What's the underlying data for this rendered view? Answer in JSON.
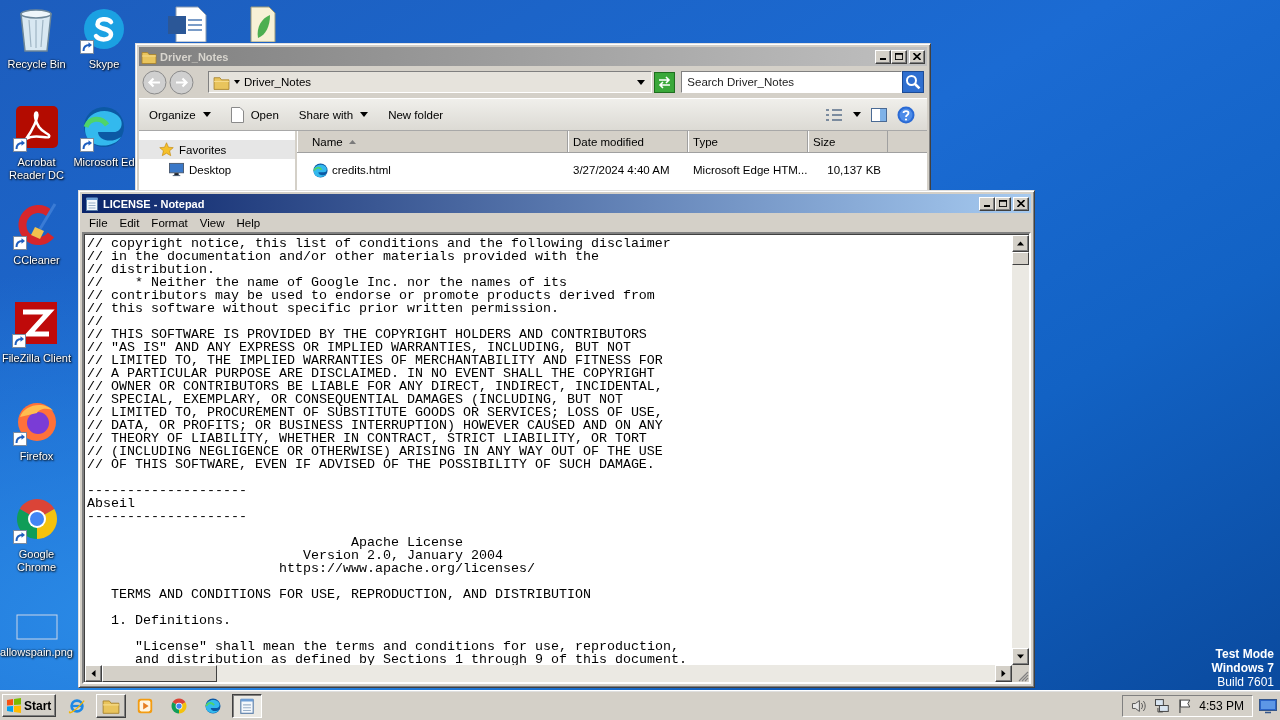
{
  "desktop": {
    "icon_columns": [
      [
        {
          "kind": "recycle-bin",
          "label": "Recycle Bin",
          "shortcut": false
        },
        {
          "kind": "acrobat",
          "label": "Acrobat Reader DC",
          "shortcut": true
        },
        {
          "kind": "ccleaner",
          "label": "CCleaner",
          "shortcut": true
        },
        {
          "kind": "filezilla",
          "label": "FileZilla Client",
          "shortcut": true
        },
        {
          "kind": "firefox",
          "label": "Firefox",
          "shortcut": true
        },
        {
          "kind": "chrome",
          "label": "Google Chrome",
          "shortcut": true
        },
        {
          "kind": "image-file",
          "label": "allowspain.png",
          "shortcut": false
        }
      ],
      [
        {
          "kind": "skype",
          "label": "Skype",
          "shortcut": true
        },
        {
          "kind": "edge",
          "label": "Microsoft Ed",
          "shortcut": true
        }
      ],
      [
        {
          "kind": "word-document"
        }
      ],
      [
        {
          "kind": "document"
        }
      ]
    ],
    "edition_lines": [
      "Test Mode",
      "Windows 7"
    ],
    "build": "Build 7601"
  },
  "explorer": {
    "title": "Driver_Notes",
    "active": false,
    "address": "Driver_Notes",
    "search": {
      "placeholder": "Search Driver_Notes"
    },
    "toolbar": [
      {
        "kind": "menu",
        "label": "Organize"
      },
      {
        "kind": "icon-command",
        "label": "Open"
      },
      {
        "kind": "menu",
        "label": "Share with"
      },
      {
        "kind": "command",
        "label": "New folder"
      }
    ],
    "nav": [
      {
        "kind": "group",
        "label": "Favorites"
      },
      {
        "kind": "location",
        "label": "Desktop"
      }
    ],
    "columns": [
      {
        "label": "Name",
        "sorted": true
      },
      {
        "label": "Date modified",
        "sorted": false
      },
      {
        "label": "Type",
        "sorted": false
      },
      {
        "label": "Size",
        "sorted": false
      }
    ],
    "rows": [
      {
        "name": "credits.html",
        "date_modified": "3/27/2024 4:40 AM",
        "type": "Microsoft Edge HTM...",
        "size": "10,137 KB"
      }
    ]
  },
  "notepad": {
    "title": "LICENSE - Notepad",
    "active": true,
    "menu": [
      "File",
      "Edit",
      "Format",
      "View",
      "Help"
    ],
    "text_blocks": [
      {
        "lines": [
          "// copyright notice, this list of conditions and the following disclaimer",
          "// in the documentation and/or other materials provided with the",
          "// distribution.",
          "//    * Neither the name of Google Inc. nor the names of its",
          "// contributors may be used to endorse or promote products derived from",
          "// this software without specific prior written permission.",
          "//",
          "// THIS SOFTWARE IS PROVIDED BY THE COPYRIGHT HOLDERS AND CONTRIBUTORS",
          "// \"AS IS\" AND ANY EXPRESS OR IMPLIED WARRANTIES, INCLUDING, BUT NOT",
          "// LIMITED TO, THE IMPLIED WARRANTIES OF MERCHANTABILITY AND FITNESS FOR",
          "// A PARTICULAR PURPOSE ARE DISCLAIMED. IN NO EVENT SHALL THE COPYRIGHT",
          "// OWNER OR CONTRIBUTORS BE LIABLE FOR ANY DIRECT, INDIRECT, INCIDENTAL,",
          "// SPECIAL, EXEMPLARY, OR CONSEQUENTIAL DAMAGES (INCLUDING, BUT NOT",
          "// LIMITED TO, PROCUREMENT OF SUBSTITUTE GOODS OR SERVICES; LOSS OF USE,",
          "// DATA, OR PROFITS; OR BUSINESS INTERRUPTION) HOWEVER CAUSED AND ON ANY",
          "// THEORY OF LIABILITY, WHETHER IN CONTRACT, STRICT LIABILITY, OR TORT",
          "// (INCLUDING NEGLIGENCE OR OTHERWISE) ARISING IN ANY WAY OUT OF THE USE",
          "// OF THIS SOFTWARE, EVEN IF ADVISED OF THE POSSIBILITY OF SUCH DAMAGE."
        ]
      },
      {
        "lines": [
          "--------------------",
          "Abseil",
          "--------------------"
        ]
      },
      {
        "lines": [
          "                                 Apache License",
          "                           Version 2.0, January 2004",
          "                        https://www.apache.org/licenses/"
        ]
      },
      {
        "lines": [
          "   TERMS AND CONDITIONS FOR USE, REPRODUCTION, AND DISTRIBUTION"
        ]
      },
      {
        "lines": [
          "   1. Definitions."
        ]
      },
      {
        "lines": [
          "      \"License\" shall mean the terms and conditions for use, reproduction,",
          "      and distribution as defined by Sections 1 through 9 of this document."
        ]
      }
    ]
  },
  "taskbar": {
    "start": "Start",
    "items": [
      {
        "kind": "internet-explorer",
        "running": false,
        "selected": false
      },
      {
        "kind": "folder",
        "running": true,
        "selected": false
      },
      {
        "kind": "media-player",
        "running": false,
        "selected": false
      },
      {
        "kind": "chrome",
        "running": false,
        "selected": false
      },
      {
        "kind": "edge",
        "running": false,
        "selected": false
      },
      {
        "kind": "notepad",
        "running": true,
        "selected": true
      }
    ],
    "clock": "4:53 PM"
  }
}
